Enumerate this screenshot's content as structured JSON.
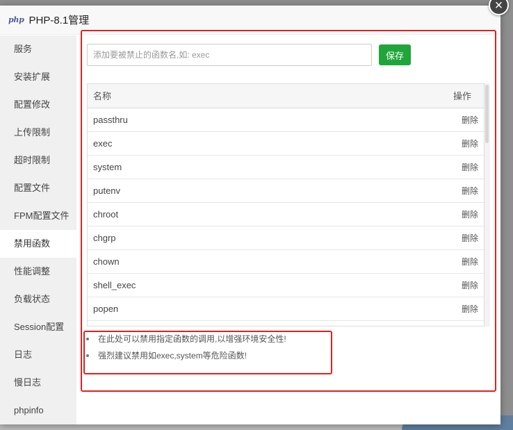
{
  "window": {
    "logo_text": "php",
    "title": "PHP-8.1管理",
    "close_symbol": "×"
  },
  "sidebar": {
    "items": [
      {
        "label": "服务"
      },
      {
        "label": "安装扩展"
      },
      {
        "label": "配置修改"
      },
      {
        "label": "上传限制"
      },
      {
        "label": "超时限制"
      },
      {
        "label": "配置文件"
      },
      {
        "label": "FPM配置文件"
      },
      {
        "label": "禁用函数",
        "active": true
      },
      {
        "label": "性能调整"
      },
      {
        "label": "负载状态"
      },
      {
        "label": "Session配置"
      },
      {
        "label": "日志"
      },
      {
        "label": "慢日志"
      },
      {
        "label": "phpinfo"
      }
    ]
  },
  "form": {
    "placeholder": "添加要被禁止的函数名,如: exec",
    "value": "",
    "save_label": "保存"
  },
  "table": {
    "columns": [
      "名称",
      "操作"
    ],
    "rows": [
      {
        "name": "passthru",
        "action": "删除"
      },
      {
        "name": "exec",
        "action": "删除"
      },
      {
        "name": "system",
        "action": "删除"
      },
      {
        "name": "putenv",
        "action": "删除"
      },
      {
        "name": "chroot",
        "action": "删除"
      },
      {
        "name": "chgrp",
        "action": "删除"
      },
      {
        "name": "chown",
        "action": "删除"
      },
      {
        "name": "shell_exec",
        "action": "删除"
      },
      {
        "name": "popen",
        "action": "删除"
      }
    ]
  },
  "tips": [
    "在此处可以禁用指定函数的调用,以增强环境安全性!",
    "强烈建议禁用如exec,system等危险函数!"
  ],
  "colors": {
    "accent_green": "#20a53a",
    "highlight_red": "#e02020"
  }
}
